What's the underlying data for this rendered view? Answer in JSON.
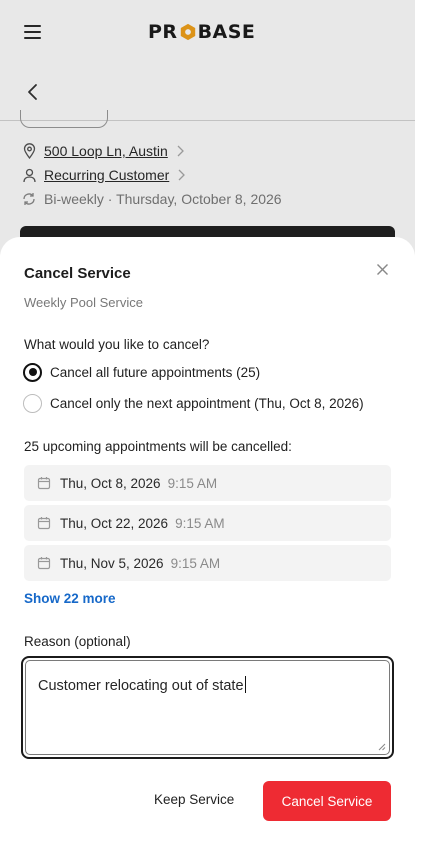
{
  "app": {
    "logo_text_left": "PR",
    "logo_text_right": "BASE"
  },
  "job": {
    "address": "500 Loop Ln, Austin",
    "customer": "Recurring Customer",
    "recurrence": "Bi-weekly · Thursday, October 8, 2026"
  },
  "modal": {
    "title": "Cancel Service",
    "subtitle": "Weekly Pool Service",
    "question": "What would you like to cancel?",
    "options": [
      {
        "label": "Cancel all future appointments (25)",
        "selected": true
      },
      {
        "label": "Cancel only the next appointment (Thu, Oct 8, 2026)",
        "selected": false
      }
    ],
    "count_text": "25 upcoming appointments will be cancelled:",
    "appointments": [
      {
        "date": "Thu, Oct 8, 2026",
        "time": "9:15 AM"
      },
      {
        "date": "Thu, Oct 22, 2026",
        "time": "9:15 AM"
      },
      {
        "date": "Thu, Nov 5, 2026",
        "time": "9:15 AM"
      }
    ],
    "show_more": "Show 22 more",
    "reason_label": "Reason (optional)",
    "reason_value": "Customer relocating out of state",
    "keep_label": "Keep Service",
    "cancel_label": "Cancel Service"
  },
  "colors": {
    "accent": "#1769c9",
    "danger": "#ee2b33",
    "logo_orange": "#f2a21b"
  }
}
